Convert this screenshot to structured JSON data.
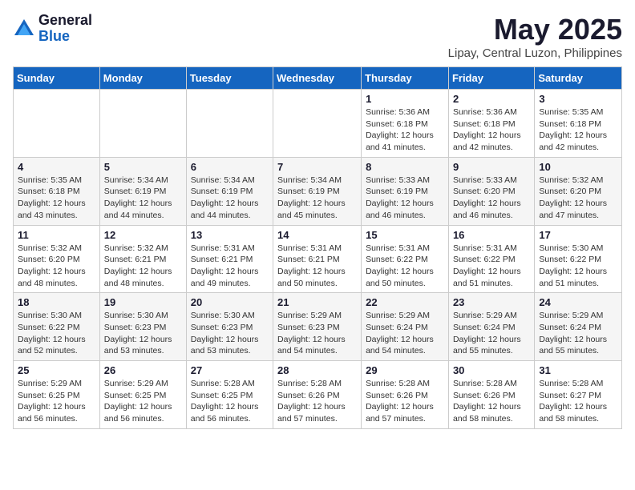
{
  "logo": {
    "general": "General",
    "blue": "Blue"
  },
  "title": "May 2025",
  "subtitle": "Lipay, Central Luzon, Philippines",
  "weekdays": [
    "Sunday",
    "Monday",
    "Tuesday",
    "Wednesday",
    "Thursday",
    "Friday",
    "Saturday"
  ],
  "weeks": [
    [
      {
        "day": "",
        "info": ""
      },
      {
        "day": "",
        "info": ""
      },
      {
        "day": "",
        "info": ""
      },
      {
        "day": "",
        "info": ""
      },
      {
        "day": "1",
        "info": "Sunrise: 5:36 AM\nSunset: 6:18 PM\nDaylight: 12 hours\nand 41 minutes."
      },
      {
        "day": "2",
        "info": "Sunrise: 5:36 AM\nSunset: 6:18 PM\nDaylight: 12 hours\nand 42 minutes."
      },
      {
        "day": "3",
        "info": "Sunrise: 5:35 AM\nSunset: 6:18 PM\nDaylight: 12 hours\nand 42 minutes."
      }
    ],
    [
      {
        "day": "4",
        "info": "Sunrise: 5:35 AM\nSunset: 6:18 PM\nDaylight: 12 hours\nand 43 minutes."
      },
      {
        "day": "5",
        "info": "Sunrise: 5:34 AM\nSunset: 6:19 PM\nDaylight: 12 hours\nand 44 minutes."
      },
      {
        "day": "6",
        "info": "Sunrise: 5:34 AM\nSunset: 6:19 PM\nDaylight: 12 hours\nand 44 minutes."
      },
      {
        "day": "7",
        "info": "Sunrise: 5:34 AM\nSunset: 6:19 PM\nDaylight: 12 hours\nand 45 minutes."
      },
      {
        "day": "8",
        "info": "Sunrise: 5:33 AM\nSunset: 6:19 PM\nDaylight: 12 hours\nand 46 minutes."
      },
      {
        "day": "9",
        "info": "Sunrise: 5:33 AM\nSunset: 6:20 PM\nDaylight: 12 hours\nand 46 minutes."
      },
      {
        "day": "10",
        "info": "Sunrise: 5:32 AM\nSunset: 6:20 PM\nDaylight: 12 hours\nand 47 minutes."
      }
    ],
    [
      {
        "day": "11",
        "info": "Sunrise: 5:32 AM\nSunset: 6:20 PM\nDaylight: 12 hours\nand 48 minutes."
      },
      {
        "day": "12",
        "info": "Sunrise: 5:32 AM\nSunset: 6:21 PM\nDaylight: 12 hours\nand 48 minutes."
      },
      {
        "day": "13",
        "info": "Sunrise: 5:31 AM\nSunset: 6:21 PM\nDaylight: 12 hours\nand 49 minutes."
      },
      {
        "day": "14",
        "info": "Sunrise: 5:31 AM\nSunset: 6:21 PM\nDaylight: 12 hours\nand 50 minutes."
      },
      {
        "day": "15",
        "info": "Sunrise: 5:31 AM\nSunset: 6:22 PM\nDaylight: 12 hours\nand 50 minutes."
      },
      {
        "day": "16",
        "info": "Sunrise: 5:31 AM\nSunset: 6:22 PM\nDaylight: 12 hours\nand 51 minutes."
      },
      {
        "day": "17",
        "info": "Sunrise: 5:30 AM\nSunset: 6:22 PM\nDaylight: 12 hours\nand 51 minutes."
      }
    ],
    [
      {
        "day": "18",
        "info": "Sunrise: 5:30 AM\nSunset: 6:22 PM\nDaylight: 12 hours\nand 52 minutes."
      },
      {
        "day": "19",
        "info": "Sunrise: 5:30 AM\nSunset: 6:23 PM\nDaylight: 12 hours\nand 53 minutes."
      },
      {
        "day": "20",
        "info": "Sunrise: 5:30 AM\nSunset: 6:23 PM\nDaylight: 12 hours\nand 53 minutes."
      },
      {
        "day": "21",
        "info": "Sunrise: 5:29 AM\nSunset: 6:23 PM\nDaylight: 12 hours\nand 54 minutes."
      },
      {
        "day": "22",
        "info": "Sunrise: 5:29 AM\nSunset: 6:24 PM\nDaylight: 12 hours\nand 54 minutes."
      },
      {
        "day": "23",
        "info": "Sunrise: 5:29 AM\nSunset: 6:24 PM\nDaylight: 12 hours\nand 55 minutes."
      },
      {
        "day": "24",
        "info": "Sunrise: 5:29 AM\nSunset: 6:24 PM\nDaylight: 12 hours\nand 55 minutes."
      }
    ],
    [
      {
        "day": "25",
        "info": "Sunrise: 5:29 AM\nSunset: 6:25 PM\nDaylight: 12 hours\nand 56 minutes."
      },
      {
        "day": "26",
        "info": "Sunrise: 5:29 AM\nSunset: 6:25 PM\nDaylight: 12 hours\nand 56 minutes."
      },
      {
        "day": "27",
        "info": "Sunrise: 5:28 AM\nSunset: 6:25 PM\nDaylight: 12 hours\nand 56 minutes."
      },
      {
        "day": "28",
        "info": "Sunrise: 5:28 AM\nSunset: 6:26 PM\nDaylight: 12 hours\nand 57 minutes."
      },
      {
        "day": "29",
        "info": "Sunrise: 5:28 AM\nSunset: 6:26 PM\nDaylight: 12 hours\nand 57 minutes."
      },
      {
        "day": "30",
        "info": "Sunrise: 5:28 AM\nSunset: 6:26 PM\nDaylight: 12 hours\nand 58 minutes."
      },
      {
        "day": "31",
        "info": "Sunrise: 5:28 AM\nSunset: 6:27 PM\nDaylight: 12 hours\nand 58 minutes."
      }
    ]
  ]
}
